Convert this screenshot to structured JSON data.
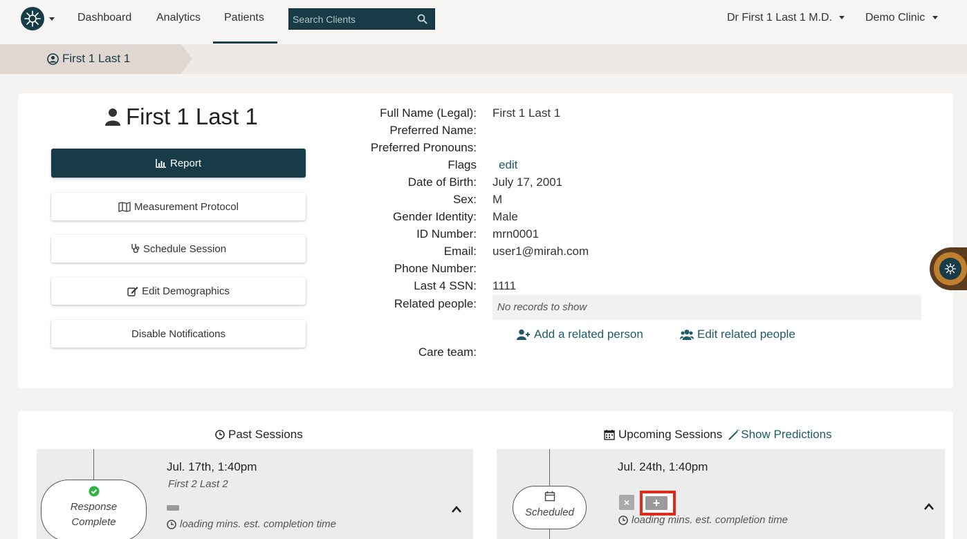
{
  "nav": {
    "links": [
      "Dashboard",
      "Analytics",
      "Patients"
    ],
    "active": "Patients",
    "search_placeholder": "Search Clients",
    "user": "Dr First 1 Last 1 M.D.",
    "clinic": "Demo Clinic"
  },
  "breadcrumb": {
    "label": "First 1 Last 1"
  },
  "patient": {
    "name": "First 1 Last 1",
    "actions": {
      "report": "Report",
      "protocol": "Measurement Protocol",
      "schedule": "Schedule Session",
      "edit_demographics": "Edit Demographics",
      "disable_notifications": "Disable Notifications"
    },
    "fields": {
      "full_name_label": "Full Name (Legal):",
      "full_name": "First 1 Last 1",
      "preferred_name_label": "Preferred Name:",
      "preferred_pronouns_label": "Preferred Pronouns:",
      "flags_label": "Flags",
      "flags_edit": "edit",
      "dob_label": "Date of Birth:",
      "dob": "July 17, 2001",
      "sex_label": "Sex:",
      "sex": "M",
      "gender_label": "Gender Identity:",
      "gender": "Male",
      "id_label": "ID Number:",
      "id": "mrn0001",
      "email_label": "Email:",
      "email": "user1@mirah.com",
      "phone_label": "Phone Number:",
      "ssn_label": "Last 4 SSN:",
      "ssn": "1111",
      "related_label": "Related people:",
      "related_empty": "No records to show",
      "add_related": "Add a related person",
      "edit_related": "Edit related people",
      "care_team_label": "Care team:"
    }
  },
  "sessions": {
    "past_title": "Past Sessions",
    "upcoming_title": "Upcoming Sessions",
    "show_predictions": "Show Predictions",
    "past": {
      "date": "Jul. 17th, 1:40pm",
      "provider": "First 2 Last 2",
      "status_line1": "Response",
      "status_line2": "Complete",
      "est": "loading mins. est. completion time"
    },
    "upcoming": {
      "date": "Jul. 24th, 1:40pm",
      "status": "Scheduled",
      "est": "loading mins. est. completion time",
      "remove_glyph": "×",
      "add_glyph": "+"
    }
  },
  "colors": {
    "brand": "#173c47",
    "link": "#1e5a68",
    "highlight": "#e02a18",
    "success": "#2fb344"
  }
}
